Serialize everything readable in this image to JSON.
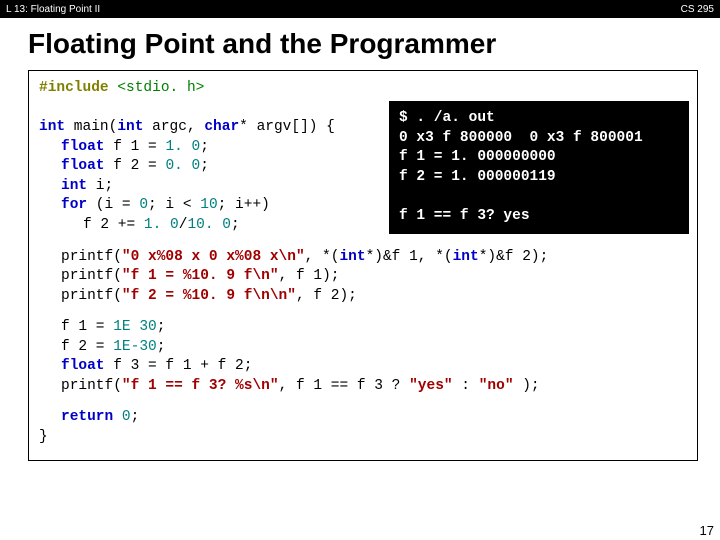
{
  "topbar": {
    "left": "L 13:  Floating Point II",
    "right": "CS 295"
  },
  "title": "Floating Point and the Programmer",
  "code": {
    "include_directive": "#include",
    "include_header": " <stdio. h>",
    "sig_kw1": "int",
    "sig_name": " main(",
    "sig_kw2": "int",
    "sig_mid": " argc, ",
    "sig_kw3": "char",
    "sig_end": "* argv[]) {",
    "b1_l1_kw": "float",
    "b1_l1_txt": " f 1 = ",
    "b1_l1_num": "1. 0",
    "b1_l2_kw": "float",
    "b1_l2_txt": " f 2 = ",
    "b1_l2_num": "0. 0",
    "b1_l3_kw": "int",
    "b1_l3_txt": " i;",
    "b1_l4_kw": "for",
    "b1_l4_a": " (i = ",
    "b1_l4_n1": "0",
    "b1_l4_b": "; i < ",
    "b1_l4_n2": "10",
    "b1_l4_c": "; i++)",
    "b1_l5_a": "f 2 += ",
    "b1_l5_n1": "1. 0",
    "b1_l5_b": "/",
    "b1_l5_n2": "10. 0",
    "b2_l1_a": "printf(",
    "b2_l1_s": "\"0 x%08 x  0 x%08 x\\n\"",
    "b2_l1_b": ", *(",
    "b2_l1_k": "int",
    "b2_l1_c": "*)&f 1, *(",
    "b2_l1_k2": "int",
    "b2_l1_d": "*)&f 2);",
    "b2_l2_a": "printf(",
    "b2_l2_s": "\"f 1 = %10. 9 f\\n\"",
    "b2_l2_b": ", f 1);",
    "b2_l3_a": "printf(",
    "b2_l3_s": "\"f 2 = %10. 9 f\\n\\n\"",
    "b2_l3_b": ", f 2);",
    "b3_l1_a": "f 1 = ",
    "b3_l1_n": "1E 30",
    "b3_l2_a": "f 2 = ",
    "b3_l2_n": "1E-30",
    "b3_l3_kw": "float",
    "b3_l3_a": " f 3 = f 1 + f 2;",
    "b3_l4_a": "printf(",
    "b3_l4_s": "\"f 1 == f 3? %s\\n\"",
    "b3_l4_b": ", f 1 == f 3 ? ",
    "b3_l4_s2": "\"yes\"",
    "b3_l4_c": " : ",
    "b3_l4_s3": "\"no\"",
    "b3_l4_d": " );",
    "ret_kw": "return",
    "ret_n": "0",
    "close": "}"
  },
  "output": "$ . /a. out\n0 x3 f 800000  0 x3 f 800001\nf 1 = 1. 000000000\nf 2 = 1. 000000119\n\nf 1 == f 3? yes",
  "pagenum": "17"
}
